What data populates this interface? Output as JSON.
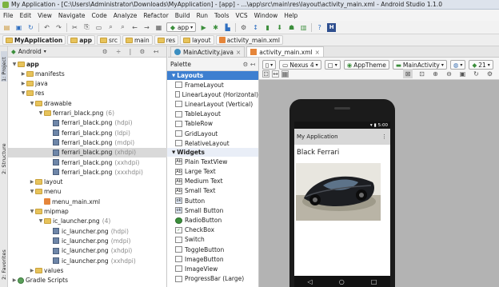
{
  "window": {
    "title": "My Application - [C:\\Users\\Administrator\\Downloads\\MyApplication] - [app] - ...\\app\\src\\main\\res\\layout\\activity_main.xml - Android Studio 1.1.0"
  },
  "menu": [
    "File",
    "Edit",
    "View",
    "Navigate",
    "Code",
    "Analyze",
    "Refactor",
    "Build",
    "Run",
    "Tools",
    "VCS",
    "Window",
    "Help"
  ],
  "toolbar": {
    "module_combo": "app"
  },
  "breadcrumbs": [
    "MyApplication",
    "app",
    "src",
    "main",
    "res",
    "layout",
    "activity_main.xml"
  ],
  "side_tabs": {
    "project": "1: Project",
    "structure": "2: Structure",
    "favorites": "2: Favorites"
  },
  "project_panel": {
    "view_mode": "Android"
  },
  "tree": [
    {
      "label": "app",
      "dim": "",
      "type": "folder",
      "expanded": true
    },
    {
      "label": "manifests",
      "dim": "",
      "type": "folder",
      "expanded": false
    },
    {
      "label": "java",
      "dim": "",
      "type": "folder",
      "expanded": false
    },
    {
      "label": "res",
      "dim": "",
      "type": "folder",
      "expanded": true
    },
    {
      "label": "drawable",
      "dim": "",
      "type": "folder",
      "expanded": true
    },
    {
      "label": "ferrari_black.png",
      "dim": "(6)",
      "type": "folder",
      "expanded": true
    },
    {
      "label": "ferrari_black.png",
      "dim": "(hdpi)",
      "type": "image",
      "expanded": false
    },
    {
      "label": "ferrari_black.png",
      "dim": "(ldpi)",
      "type": "image",
      "expanded": false
    },
    {
      "label": "ferrari_black.png",
      "dim": "(mdpi)",
      "type": "image",
      "expanded": false
    },
    {
      "label": "ferrari_black.png",
      "dim": "(xhdpi)",
      "type": "image",
      "expanded": false
    },
    {
      "label": "ferrari_black.png",
      "dim": "(xxhdpi)",
      "type": "image",
      "expanded": false
    },
    {
      "label": "ferrari_black.png",
      "dim": "(xxxhdpi)",
      "type": "image",
      "expanded": false
    },
    {
      "label": "layout",
      "dim": "",
      "type": "folder",
      "expanded": false
    },
    {
      "label": "menu",
      "dim": "",
      "type": "folder",
      "expanded": true
    },
    {
      "label": "menu_main.xml",
      "dim": "",
      "type": "xml",
      "expanded": false
    },
    {
      "label": "mipmap",
      "dim": "",
      "type": "folder",
      "expanded": true
    },
    {
      "label": "ic_launcher.png",
      "dim": "(4)",
      "type": "folder",
      "expanded": true
    },
    {
      "label": "ic_launcher.png",
      "dim": "(hdpi)",
      "type": "image",
      "expanded": false
    },
    {
      "label": "ic_launcher.png",
      "dim": "(mdpi)",
      "type": "image",
      "expanded": false
    },
    {
      "label": "ic_launcher.png",
      "dim": "(xhdpi)",
      "type": "image",
      "expanded": false
    },
    {
      "label": "ic_launcher.png",
      "dim": "(xxhdpi)",
      "type": "image",
      "expanded": false
    },
    {
      "label": "values",
      "dim": "",
      "type": "folder",
      "expanded": false
    },
    {
      "label": "Gradle Scripts",
      "dim": "",
      "type": "gradle",
      "expanded": false
    }
  ],
  "editor_tabs": [
    {
      "label": "MainActivity.java",
      "active": false
    },
    {
      "label": "activity_main.xml",
      "active": true
    }
  ],
  "palette": {
    "title": "Palette",
    "groups": [
      {
        "name": "Layouts",
        "items": [
          "FrameLayout",
          "LinearLayout (Horizontal)",
          "LinearLayout (Vertical)",
          "TableLayout",
          "TableRow",
          "GridLayout",
          "RelativeLayout"
        ]
      },
      {
        "name": "Widgets",
        "items": [
          "Plain TextView",
          "Large Text",
          "Medium Text",
          "Small Text",
          "Button",
          "Small Button",
          "RadioButton",
          "CheckBox",
          "Switch",
          "ToggleButton",
          "ImageButton",
          "ImageView",
          "ProgressBar (Large)"
        ]
      }
    ]
  },
  "design_toolbar": {
    "device": "Nexus 4",
    "theme": "AppTheme",
    "activity": "MainActivity",
    "api": "21"
  },
  "preview": {
    "status_time": "5:00",
    "app_title": "My Application",
    "text": "Black Ferrari"
  },
  "colors": {
    "accent": "#3d7fd0",
    "selection": "#d9d9d9"
  }
}
